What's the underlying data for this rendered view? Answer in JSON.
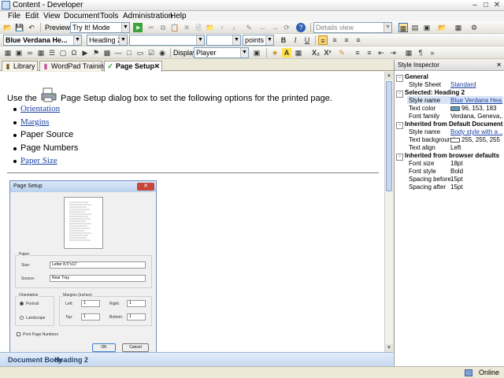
{
  "window": {
    "title": "Content - Developer"
  },
  "menu": [
    "File",
    "Edit",
    "View",
    "Document",
    "Tools",
    "Administration",
    "Help"
  ],
  "toolbar1": {
    "preview_label": "Preview:",
    "preview_mode": "Try It! Mode",
    "view_mode": "Details view"
  },
  "toolbar2": {
    "style_combo": "Blue Verdana He...",
    "heading_combo": "Heading 2",
    "font_combo": "",
    "size_combo": "",
    "unit_combo": "points",
    "bold": "B",
    "italic": "I",
    "underline": "U"
  },
  "toolbar3": {
    "display_label": "Display:",
    "display_value": "Player",
    "subscript": "X₂",
    "superscript": "X²"
  },
  "tabs": [
    {
      "label": "Library",
      "active": false
    },
    {
      "label": "WordPad Training",
      "active": false
    },
    {
      "label": "Page Setup",
      "active": true
    }
  ],
  "document": {
    "intro_before": "Use the",
    "intro_after": "Page Setup dialog box to set the following options for the printed page.",
    "items": [
      {
        "text": "Orientation",
        "link": true
      },
      {
        "text": "Margins",
        "link": true
      },
      {
        "text": "Paper Source",
        "link": false
      },
      {
        "text": "Page Numbers",
        "link": false
      },
      {
        "text": "Paper Size",
        "link": true
      }
    ]
  },
  "dialog": {
    "title": "Page Setup",
    "paper_group": "Paper",
    "size_label": "Size:",
    "size_value": "Letter 8.5\"x11\"",
    "source_label": "Source:",
    "source_value": "Rear Tray",
    "orientation_group": "Orientation",
    "portrait": "Portrait",
    "landscape": "Landscape",
    "margins_group": "Margins (inches)",
    "left_label": "Left:",
    "left_value": "1",
    "right_label": "Right:",
    "right_value": "1",
    "top_label": "Top:",
    "top_value": "1",
    "bottom_label": "Bottom:",
    "bottom_value": "1",
    "print_page_numbers": "Print Page Numbers",
    "ok": "OK",
    "cancel": "Cancel"
  },
  "breadcrumb": [
    "Document Body",
    "Heading 2"
  ],
  "inspector": {
    "title": "Style Inspector",
    "general": "General",
    "style_sheet_key": "Style Sheet",
    "style_sheet_val": "Standard",
    "selected": "Selected: Heading 2",
    "style_name_key": "Style name",
    "style_name_val": "Blue Verdana Hea...",
    "text_color_key": "Text color",
    "text_color_val": "96, 153, 183",
    "text_color_hex": "#6099b7",
    "font_family_key": "Font family",
    "font_family_val": "Verdana, Geneva,...",
    "inherited_doc": "Inherited from Default Document Bo",
    "style_name2_key": "Style name",
    "style_name2_val": "Body style with a ...",
    "text_bg_key": "Text background",
    "text_bg_val": "255, 255, 255",
    "text_bg_hex": "#ffffff",
    "text_align_key": "Text align",
    "text_align_val": "Left",
    "inherited_browser": "Inherited from browser defaults",
    "font_size_key": "Font size",
    "font_size_val": "18pt",
    "font_style_key": "Font style",
    "font_style_val": "Bold",
    "spacing_before_key": "Spacing before",
    "spacing_before_val": "15pt",
    "spacing_after_key": "Spacing after",
    "spacing_after_val": "15pt"
  },
  "status": {
    "text": "Online"
  }
}
